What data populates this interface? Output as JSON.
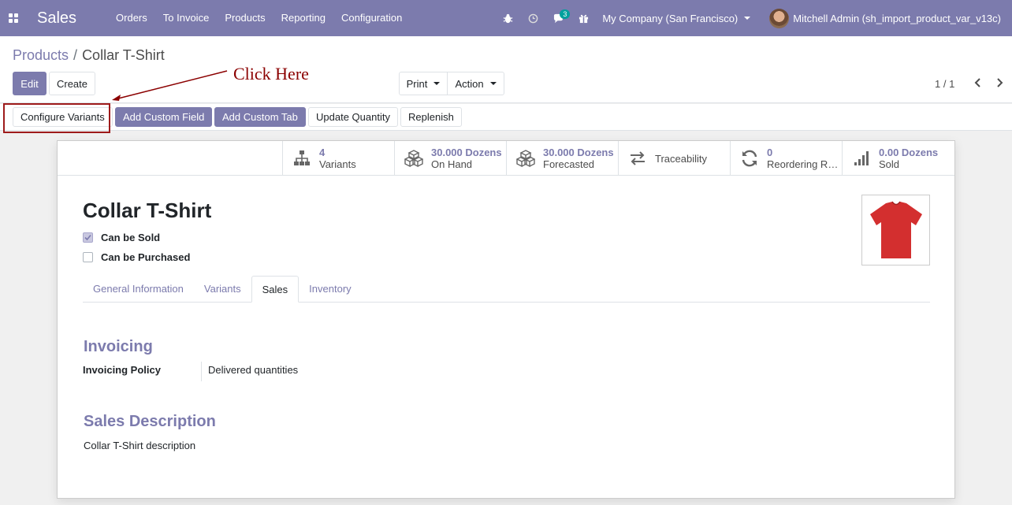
{
  "navbar": {
    "app_name": "Sales",
    "menu": [
      "Orders",
      "To Invoice",
      "Products",
      "Reporting",
      "Configuration"
    ],
    "messages_badge": "3",
    "company": "My Company (San Francisco)",
    "user": "Mitchell Admin (sh_import_product_var_v13c)"
  },
  "breadcrumb": {
    "parent": "Products",
    "separator": "/",
    "current": "Collar T-Shirt"
  },
  "control": {
    "edit_label": "Edit",
    "create_label": "Create",
    "print_label": "Print",
    "action_label": "Action",
    "pager": "1 / 1"
  },
  "header_buttons": {
    "configure_variants": "Configure Variants",
    "add_custom_field": "Add Custom Field",
    "add_custom_tab": "Add Custom Tab",
    "update_quantity": "Update Quantity",
    "replenish": "Replenish"
  },
  "annotation": {
    "text": "Click Here",
    "color": "#8b0000"
  },
  "smart_buttons": {
    "variants": {
      "value": "4",
      "label": "Variants"
    },
    "on_hand": {
      "value": "30.000 Dozens",
      "label": "On Hand"
    },
    "forecasted": {
      "value": "30.000 Dozens",
      "label": "Forecasted"
    },
    "traceability": {
      "label": "Traceability"
    },
    "reordering": {
      "value": "0",
      "label": "Reordering Rules"
    },
    "sold": {
      "value": "0.00 Dozens",
      "label": "Sold"
    }
  },
  "product": {
    "name": "Collar T-Shirt",
    "can_be_sold_label": "Can be Sold",
    "can_be_sold": true,
    "can_be_purchased_label": "Can be Purchased",
    "can_be_purchased": false,
    "image_color": "#d32f2f"
  },
  "tabs": [
    "General Information",
    "Variants",
    "Sales",
    "Inventory"
  ],
  "active_tab": "Sales",
  "sales_tab": {
    "invoicing_title": "Invoicing",
    "invoicing_policy_label": "Invoicing Policy",
    "invoicing_policy_value": "Delivered quantities",
    "description_title": "Sales Description",
    "description": "Collar T-Shirt description"
  },
  "colors": {
    "brand": "#7c7bad",
    "badge": "#00a09d"
  }
}
